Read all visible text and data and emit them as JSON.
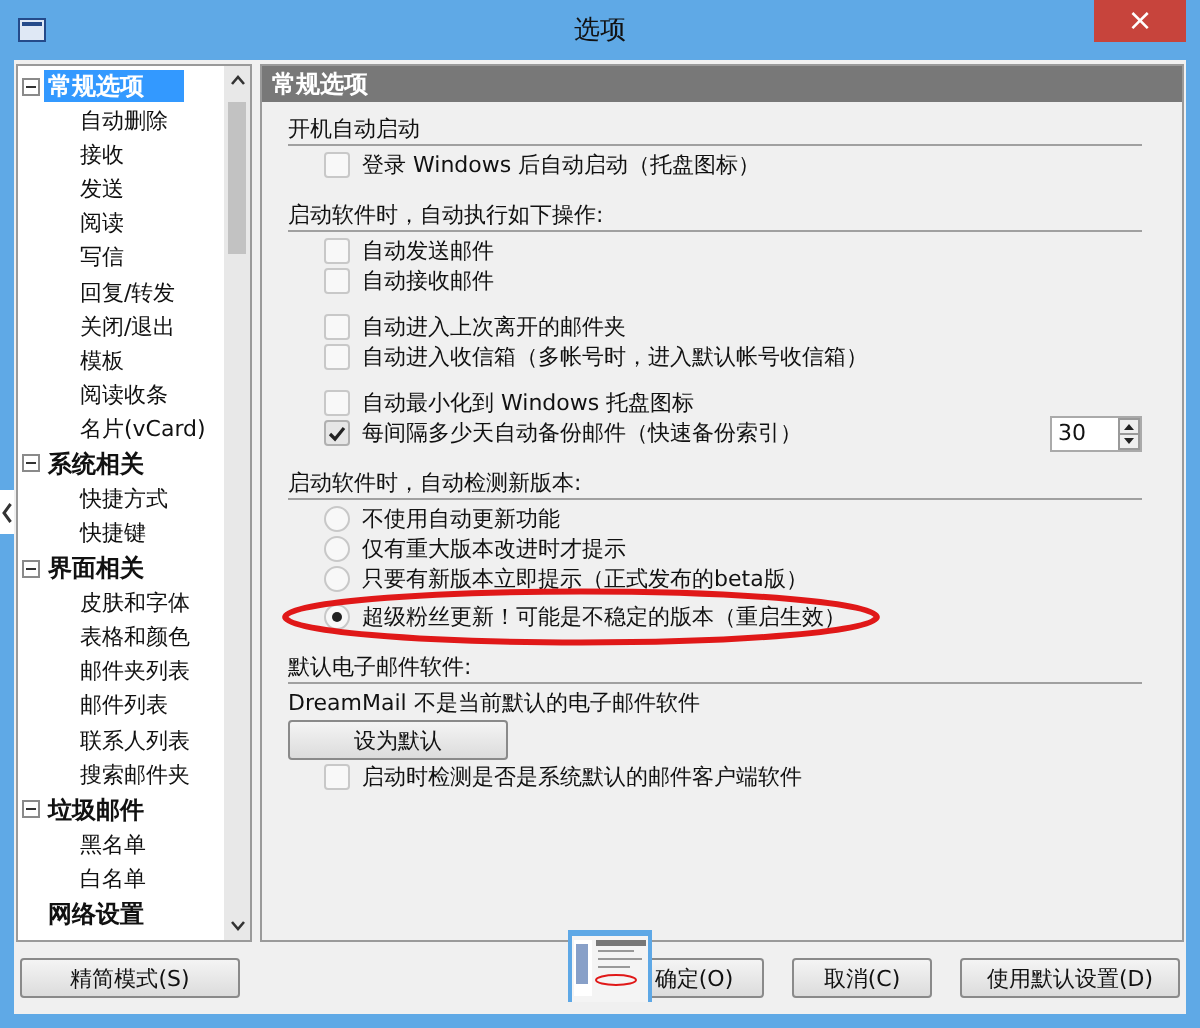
{
  "window": {
    "title": "选项",
    "close": "×"
  },
  "tree": [
    {
      "label": "常规选项",
      "expanded": true,
      "selected": true,
      "children": [
        {
          "label": "自动删除",
          "selected": false
        },
        {
          "label": "接收",
          "selected": false
        },
        {
          "label": "发送",
          "selected": false
        },
        {
          "label": "阅读",
          "selected": false
        },
        {
          "label": "写信",
          "selected": false
        },
        {
          "label": "回复/转发",
          "selected": false
        },
        {
          "label": "关闭/退出",
          "selected": false
        },
        {
          "label": "模板",
          "selected": false
        },
        {
          "label": "阅读收条",
          "selected": false
        },
        {
          "label": "名片(vCard)",
          "selected": false
        }
      ]
    },
    {
      "label": "系统相关",
      "expanded": true,
      "selected": false,
      "children": [
        {
          "label": "快捷方式",
          "selected": false
        },
        {
          "label": "快捷键",
          "selected": false
        }
      ]
    },
    {
      "label": "界面相关",
      "expanded": true,
      "selected": false,
      "children": [
        {
          "label": "皮肤和字体",
          "selected": false
        },
        {
          "label": "表格和颜色",
          "selected": false
        },
        {
          "label": "邮件夹列表",
          "selected": false
        },
        {
          "label": "邮件列表",
          "selected": false
        },
        {
          "label": "联系人列表",
          "selected": false
        },
        {
          "label": "搜索邮件夹",
          "selected": false
        }
      ]
    },
    {
      "label": "垃圾邮件",
      "expanded": true,
      "selected": false,
      "children": [
        {
          "label": "黑名单",
          "selected": false
        },
        {
          "label": "白名单",
          "selected": false
        }
      ]
    },
    {
      "label": "网络设置",
      "selected": false
    }
  ],
  "panel": {
    "title": "常规选项",
    "sections": [
      {
        "title": "开机自动启动",
        "groups": [
          [
            {
              "kind": "checkbox",
              "label": "登录 Windows 后自动启动（托盘图标）",
              "checked": false
            }
          ]
        ]
      },
      {
        "title": "启动软件时，自动执行如下操作:",
        "groups": [
          [
            {
              "kind": "checkbox",
              "label": "自动发送邮件",
              "checked": false
            },
            {
              "kind": "checkbox",
              "label": "自动接收邮件",
              "checked": false
            }
          ],
          [
            {
              "kind": "checkbox",
              "label": "自动进入上次离开的邮件夹",
              "checked": false
            },
            {
              "kind": "checkbox",
              "label": "自动进入收信箱（多帐号时，进入默认帐号收信箱）",
              "checked": false
            }
          ],
          [
            {
              "kind": "checkbox",
              "label": "自动最小化到 Windows 托盘图标",
              "checked": false
            },
            {
              "kind": "spin",
              "label": "每间隔多少天自动备份邮件（快速备份索引）",
              "checked": true,
              "value": "30"
            }
          ]
        ]
      },
      {
        "title": "启动软件时，自动检测新版本:",
        "groups": [
          [
            {
              "kind": "radio",
              "label": "不使用自动更新功能",
              "selected": false
            },
            {
              "kind": "radio",
              "label": "仅有重大版本改进时才提示",
              "selected": false
            },
            {
              "kind": "radio",
              "label": "只要有新版本立即提示（正式发布的beta版）",
              "selected": false
            },
            {
              "kind": "radio",
              "label": "超级粉丝更新！可能是不稳定的版本（重启生效）",
              "selected": true,
              "highlighted": true
            }
          ]
        ]
      },
      {
        "title": "默认电子邮件软件:",
        "groups": [
          [
            {
              "kind": "text",
              "label": "DreamMail 不是当前默认的电子邮件软件"
            },
            {
              "kind": "button",
              "label": "设为默认"
            },
            {
              "kind": "checkbox",
              "label": "启动时检测是否是系统默认的邮件客户端软件",
              "checked": false
            }
          ]
        ]
      }
    ]
  },
  "buttons": {
    "left": "精简模式(S)",
    "right": [
      "确定(O)",
      "取消(C)",
      "使用默认设置(D)"
    ]
  }
}
